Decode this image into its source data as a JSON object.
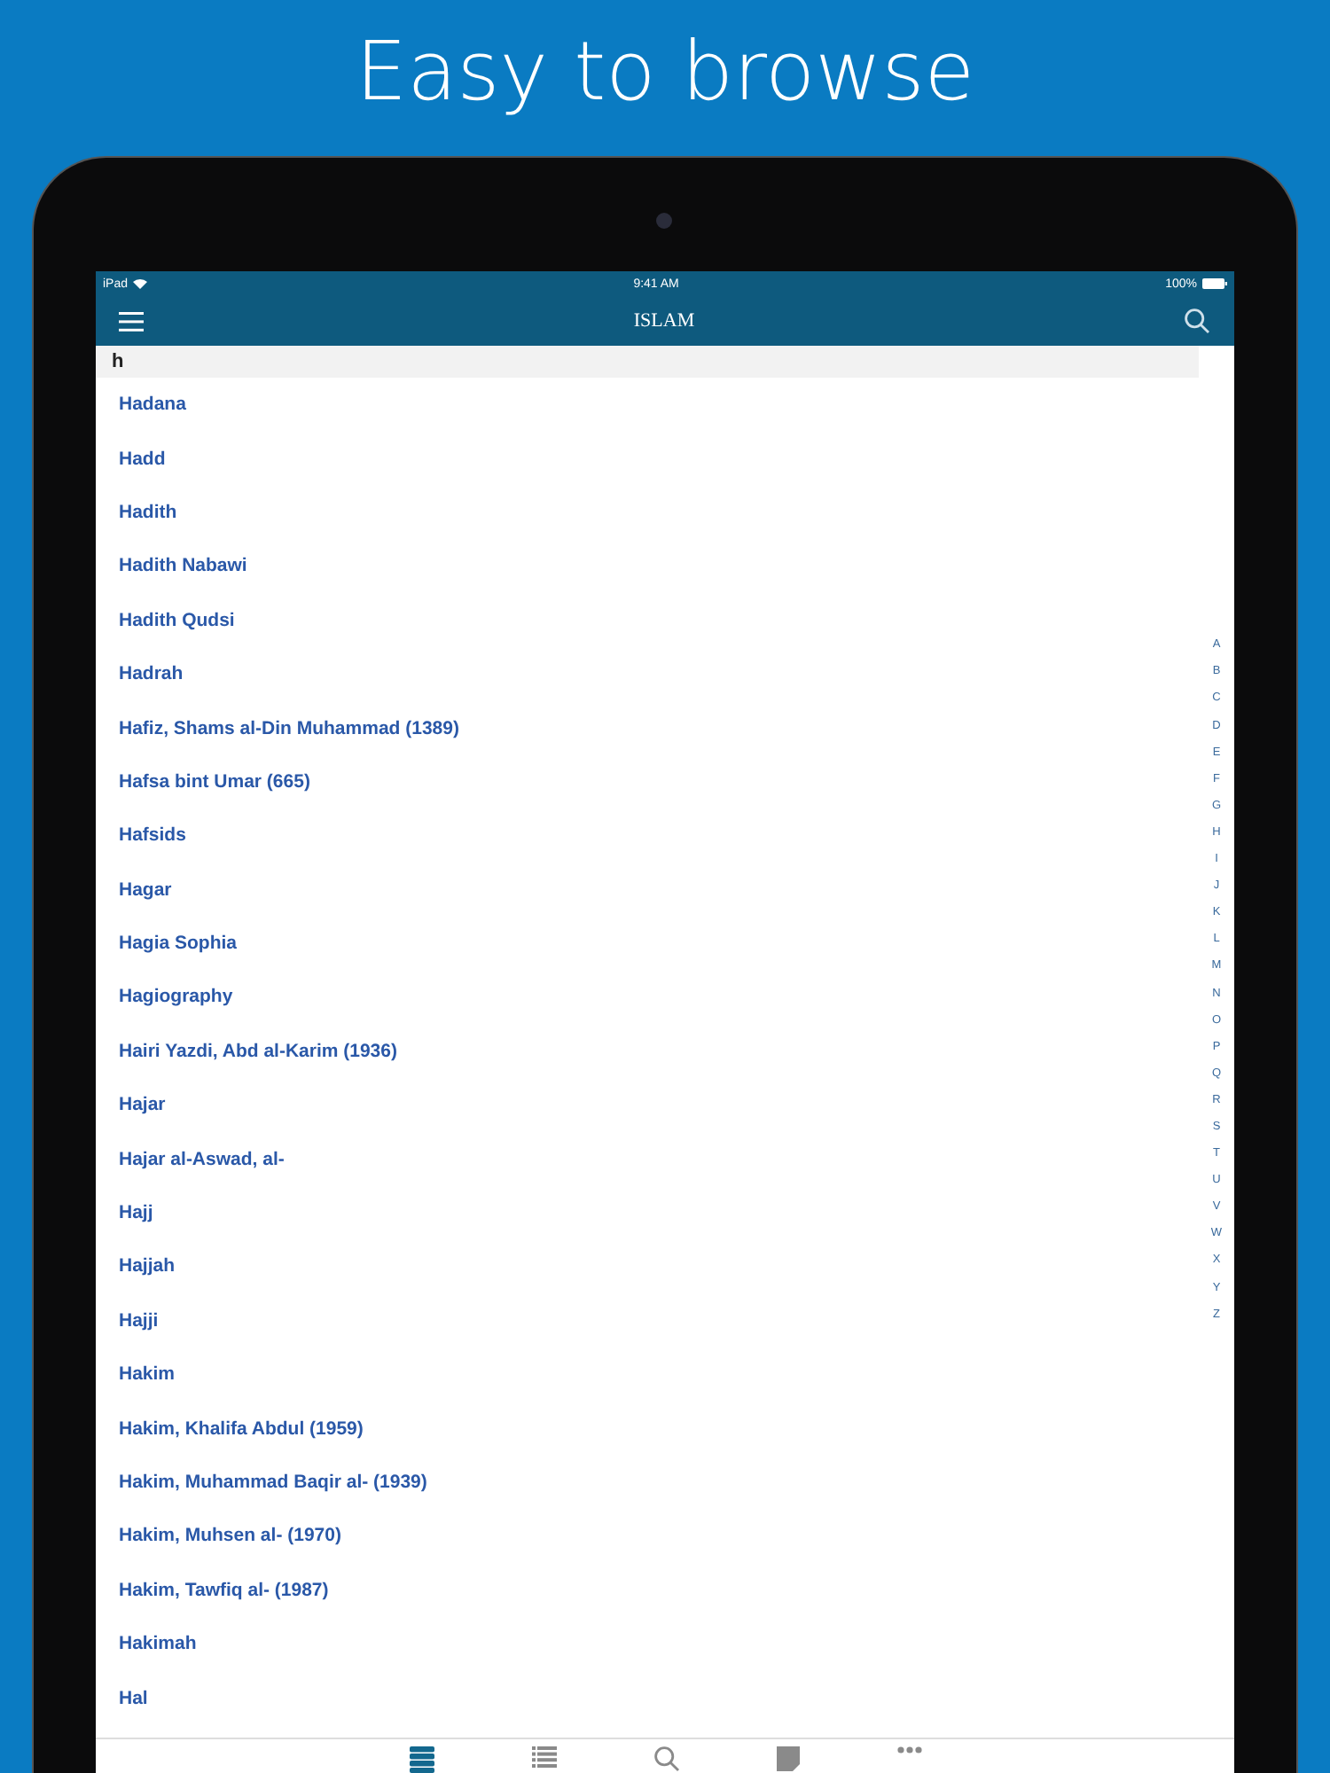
{
  "headline": "Easy to browse",
  "status_bar": {
    "device": "iPad",
    "time": "9:41 AM",
    "battery": "100%"
  },
  "nav": {
    "title": "ISLAM"
  },
  "section": {
    "header": "h"
  },
  "entries": [
    "Hadana",
    "Hadd",
    "Hadith",
    "Hadith Nabawi",
    "Hadith Qudsi",
    "Hadrah",
    "Hafiz, Shams al-Din Muhammad (1389)",
    "Hafsa bint Umar (665)",
    "Hafsids",
    "Hagar",
    "Hagia Sophia",
    "Hagiography",
    "Hairi Yazdi, Abd al-Karim (1936)",
    "Hajar",
    "Hajar al-Aswad, al-",
    "Hajj",
    "Hajjah",
    "Hajji",
    "Hakim",
    "Hakim, Khalifa Abdul (1959)",
    "Hakim, Muhammad Baqir al- (1939)",
    "Hakim, Muhsen al- (1970)",
    "Hakim, Tawfiq al- (1987)",
    "Hakimah",
    "Hal"
  ],
  "index_letters": [
    "A",
    "B",
    "C",
    "D",
    "E",
    "F",
    "G",
    "H",
    "I",
    "J",
    "K",
    "L",
    "M",
    "N",
    "O",
    "P",
    "Q",
    "R",
    "S",
    "T",
    "U",
    "V",
    "W",
    "X",
    "Y",
    "Z"
  ],
  "tabs": [
    {
      "kind": "books",
      "selected": true
    },
    {
      "kind": "list",
      "selected": false
    },
    {
      "kind": "search",
      "selected": false
    },
    {
      "kind": "note",
      "selected": false
    },
    {
      "kind": "more",
      "selected": false
    }
  ]
}
